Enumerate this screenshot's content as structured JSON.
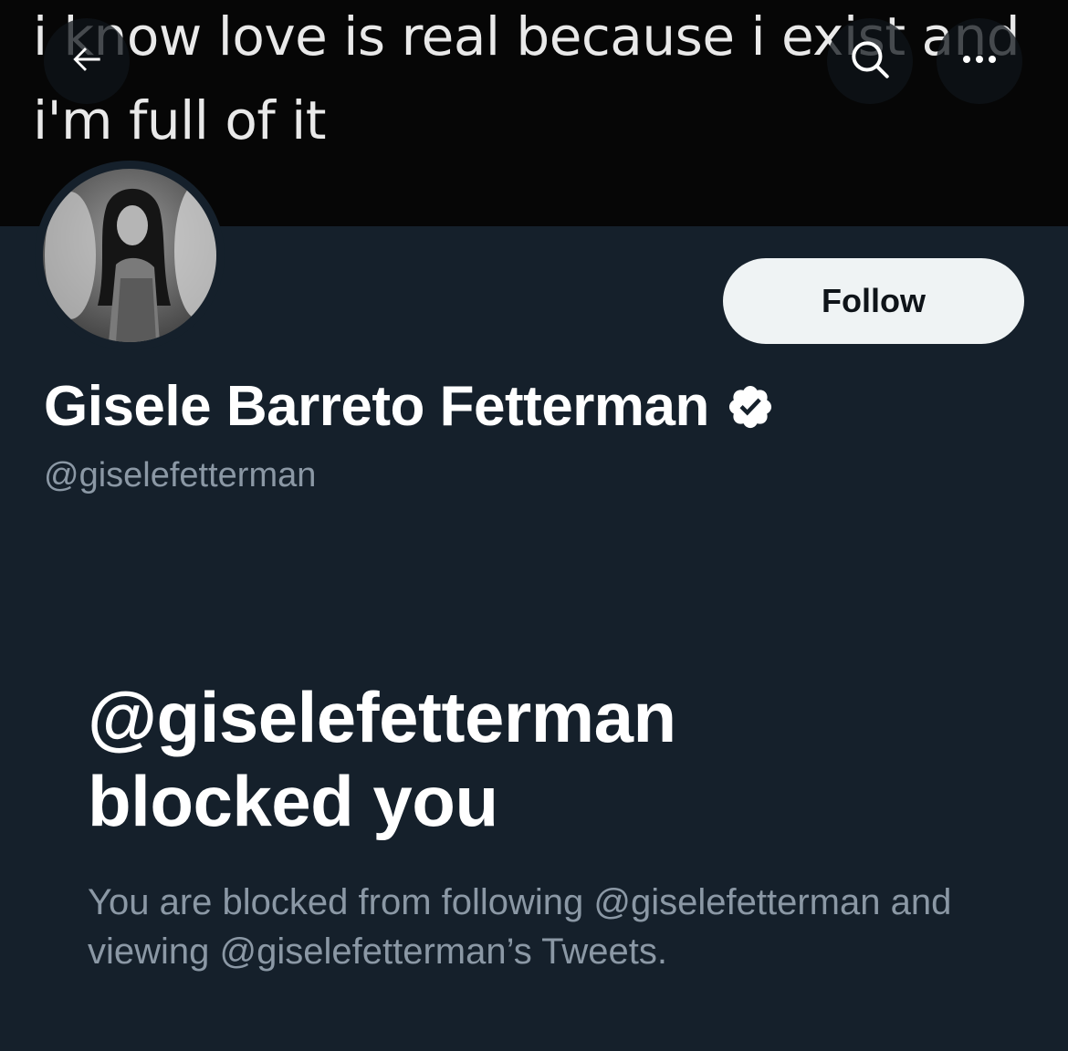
{
  "banner": {
    "text": "i know love is real because i exist and i'm full of it"
  },
  "header": {
    "back_icon": "arrow-left-icon",
    "search_icon": "search-icon",
    "more_icon": "more-horizontal-icon"
  },
  "profile": {
    "display_name": "Gisele Barreto Fetterman",
    "handle": "@giselefetterman",
    "verified_icon": "verified-badge-icon",
    "follow_label": "Follow"
  },
  "blocked": {
    "title_line1": "@giselefetterman",
    "title_line2": "blocked you",
    "description": "You are blocked from following @giselefetterman and viewing @giselefetterman’s Tweets."
  },
  "colors": {
    "background": "#15202b",
    "banner": "#060606",
    "follow_button": "#eff3f4",
    "secondary_text": "#8b98a5"
  }
}
